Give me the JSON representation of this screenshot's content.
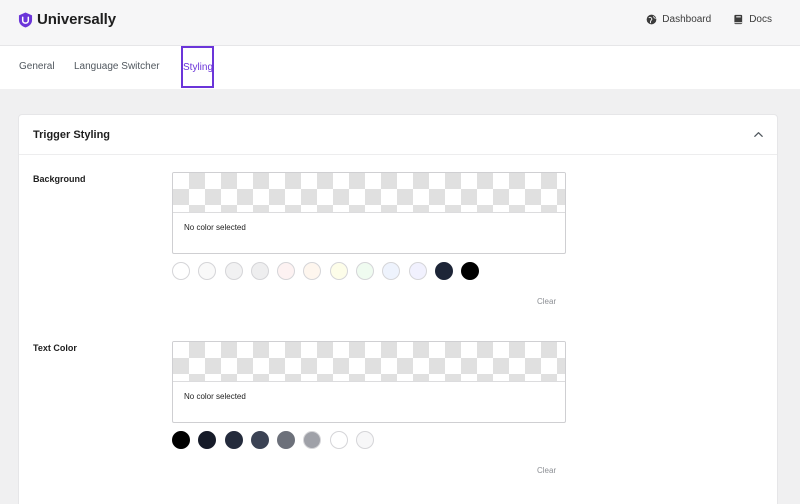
{
  "app": {
    "name": "Universally",
    "brand_color": "#6b35d9"
  },
  "header": {
    "links": [
      {
        "label": "Dashboard",
        "icon": "globe-icon"
      },
      {
        "label": "Docs",
        "icon": "book-icon"
      }
    ]
  },
  "tabs": [
    {
      "label": "General",
      "active": false
    },
    {
      "label": "Language Switcher",
      "active": false
    },
    {
      "label": "Styling",
      "active": true
    }
  ],
  "section": {
    "title": "Trigger Styling",
    "collapse_icon": "chevron-up-icon",
    "fields": [
      {
        "label": "Background",
        "value": "No color selected",
        "clear_label": "Clear",
        "swatches": [
          "#ffffff",
          "#f9f9f9",
          "#f1f1f2",
          "#eeeeef",
          "#fdf2f2",
          "#fef6ee",
          "#fdfde9",
          "#effbf0",
          "#eef3fd",
          "#f1f1fe",
          "#1d2537",
          "#000000"
        ]
      },
      {
        "label": "Text Color",
        "value": "No color selected",
        "clear_label": "Clear",
        "swatches": [
          "#000000",
          "#161b29",
          "#242b3c",
          "#3b4254",
          "#6c707a",
          "#9fa1a8",
          "#ffffff",
          "#f7f7f8"
        ]
      }
    ]
  }
}
